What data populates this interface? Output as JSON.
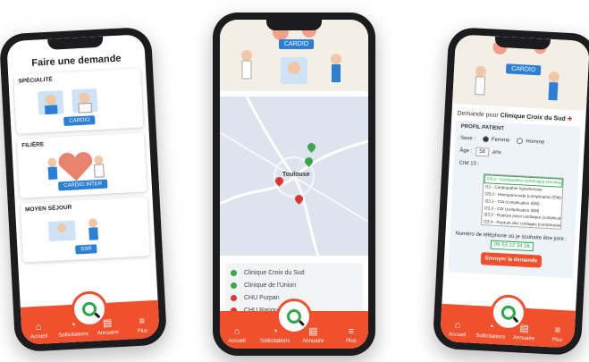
{
  "nav": {
    "items": [
      {
        "label": "Accueil",
        "icon": "home-icon"
      },
      {
        "label": "Sollicitations",
        "icon": "bell-icon"
      },
      {
        "label": "Annuaire",
        "icon": "book-icon"
      },
      {
        "label": "Plus",
        "icon": "menu-icon"
      }
    ]
  },
  "phone1": {
    "title": "Faire une demande",
    "cards": [
      {
        "heading": "SPÉCIALITÉ",
        "pill": "CARDIO"
      },
      {
        "heading": "FILIÈRE",
        "pill": "CARDIO INTER"
      },
      {
        "heading": "MOYEN SÉJOUR",
        "pill": "SSR"
      }
    ]
  },
  "phone2": {
    "tag": "CARDIO",
    "map_label": "Toulouse",
    "clinics": [
      {
        "name": "Clinique Croix du Sud",
        "color": "#3aa64a"
      },
      {
        "name": "Clinique de l'Union",
        "color": "#3aa64a"
      },
      {
        "name": "CHU Purpan",
        "color": "#e0342c"
      },
      {
        "name": "CHU Rangueil",
        "color": "#e0342c"
      }
    ]
  },
  "phone3": {
    "tag": "CARDIO",
    "demande_prefix": "Demande pour",
    "demande_name": "Clinique Croix du Sud",
    "profile_title": "PROFIL PATIENT",
    "sexe_label": "Sexe :",
    "femme": "Femme",
    "homme": "Homme",
    "age_label": "Âge :",
    "age_value": "58",
    "age_unit": "ans",
    "cim_label": "CIM 10 :",
    "cim_options": [
      "I25.9 - Cardiopathie ischémique chroniqu",
      "I11 - Cardiopathie hypertensive",
      "I25.0 - Hémopéricarde (complication IDM)",
      "I23.1 - CIA (complication IDM)",
      "I23.2 - CIV (complication IDM)",
      "I23.3 - Rupture paroi cardiaque (complicatio",
      "I23.4 - Rupture des cordages (complication ID"
    ],
    "phone_label": "Numéro de téléphone où je souhaite être joint :",
    "phone_value": "06 63 12 34 56",
    "submit": "Envoyer la demande"
  }
}
